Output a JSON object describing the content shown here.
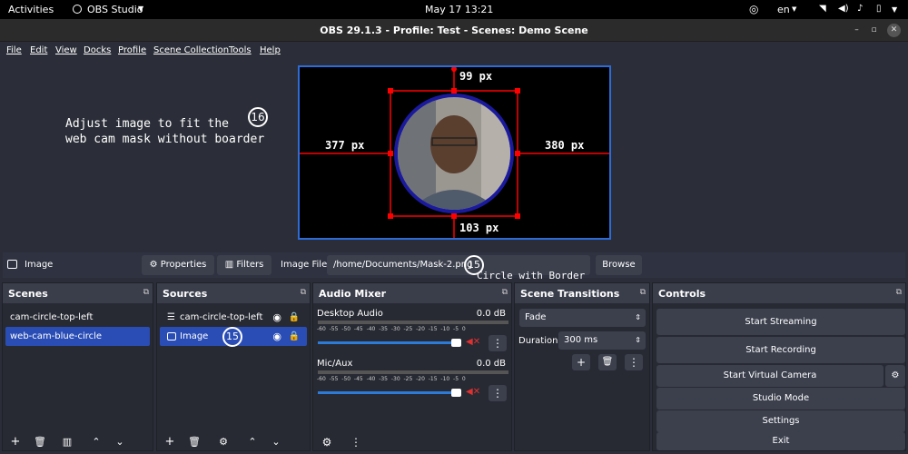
{
  "system_bar": {
    "activities": "Activities",
    "app_name": "OBS Studio",
    "clock": "May 17  13:21",
    "language": "en"
  },
  "window": {
    "title": "OBS 29.1.3 - Profile: Test - Scenes: Demo Scene"
  },
  "menu": [
    "File",
    "Edit",
    "View",
    "Docks",
    "Profile",
    "Scene Collection",
    "Tools",
    "Help"
  ],
  "preview": {
    "annotation_text_line1": "Adjust image to fit the",
    "annotation_text_line2": "web cam mask without boarder",
    "badge_16": "16",
    "dist_top": "99 px",
    "dist_left": "377 px",
    "dist_right": "380 px",
    "dist_bottom": "103 px"
  },
  "properties_bar": {
    "source_name": "Image",
    "properties_label": "Properties",
    "filters_label": "Filters",
    "image_file_label": "Image File",
    "image_file_value": "/home/Documents/Mask-2.png",
    "badge_15": "15",
    "annotation": "Circle with Border",
    "browse_label": "Browse"
  },
  "scenes": {
    "title": "Scenes",
    "items": [
      "cam-circle-top-left",
      "web-cam-blue-circle"
    ],
    "selected": 1
  },
  "sources": {
    "title": "Sources",
    "items": [
      "cam-circle-top-left",
      "Image"
    ],
    "selected": 1,
    "badge": "15"
  },
  "audio_mixer": {
    "title": "Audio Mixer",
    "scale": [
      "-60",
      "-55",
      "-50",
      "-45",
      "-40",
      "-35",
      "-30",
      "-25",
      "-20",
      "-15",
      "-10",
      "-5",
      "0"
    ],
    "channels": [
      {
        "name": "Desktop Audio",
        "level": "0.0 dB"
      },
      {
        "name": "Mic/Aux",
        "level": "0.0 dB"
      }
    ]
  },
  "scene_transitions": {
    "title": "Scene Transitions",
    "transition": "Fade",
    "duration_label": "Duration",
    "duration_value": "300 ms"
  },
  "controls": {
    "title": "Controls",
    "buttons": [
      "Start Streaming",
      "Start Recording",
      "Start Virtual Camera",
      "Studio Mode",
      "Settings",
      "Exit"
    ]
  },
  "colors": {
    "accent": "#2c6bd8",
    "selection": "#2a4db5",
    "mute_red": "#e03030",
    "guide_red": "#ff0000"
  }
}
